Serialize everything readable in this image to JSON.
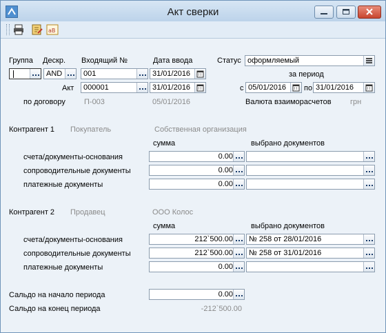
{
  "window": {
    "title": "Акт сверки"
  },
  "header": {
    "group_label": "Группа",
    "descr_label": "Дескр.",
    "incoming_label": "Входящий №",
    "entry_date_label": "Дата ввода",
    "status_label": "Статус",
    "group_value": "",
    "descr_value": "AND",
    "incoming_value": "001",
    "entry_date_value": "31/01/2016",
    "status_value": "оформляемый",
    "period_label": "за период",
    "act_label": "Акт",
    "act_value": "000001",
    "act_date_value": "31/01/2016",
    "from_label": "с",
    "from_value": "05/01/2016",
    "to_label": "по",
    "to_value": "31/01/2016",
    "contract_label": "по договору",
    "contract_value": "П-003",
    "contract_date": "05/01/2016",
    "currency_label": "Валюта взаиморасчетов",
    "currency_value": "грн"
  },
  "counterparty1": {
    "title": "Контрагент 1",
    "role": "Покупатель",
    "name": "Собственная организация",
    "sum_header": "сумма",
    "docs_header": "выбрано документов",
    "rows": [
      {
        "label": "счета/документы-основания",
        "sum": "0.00",
        "docs": ""
      },
      {
        "label": "сопроводительные документы",
        "sum": "0.00",
        "docs": ""
      },
      {
        "label": "платежные документы",
        "sum": "0.00",
        "docs": ""
      }
    ]
  },
  "counterparty2": {
    "title": "Контрагент 2",
    "role": "Продавец",
    "name": "ООО Колос",
    "sum_header": "сумма",
    "docs_header": "выбрано документов",
    "rows": [
      {
        "label": "счета/документы-основания",
        "sum": "212`500.00",
        "docs": "№ 258 от 28/01/2016"
      },
      {
        "label": "сопроводительные документы",
        "sum": "212`500.00",
        "docs": "№ 258 от 31/01/2016"
      },
      {
        "label": "платежные документы",
        "sum": "0.00",
        "docs": ""
      }
    ]
  },
  "balance": {
    "start_label": "Сальдо на начало периода",
    "start_value": "0.00",
    "end_label": "Сальдо на конец периода",
    "end_value": "-212`500.00"
  }
}
